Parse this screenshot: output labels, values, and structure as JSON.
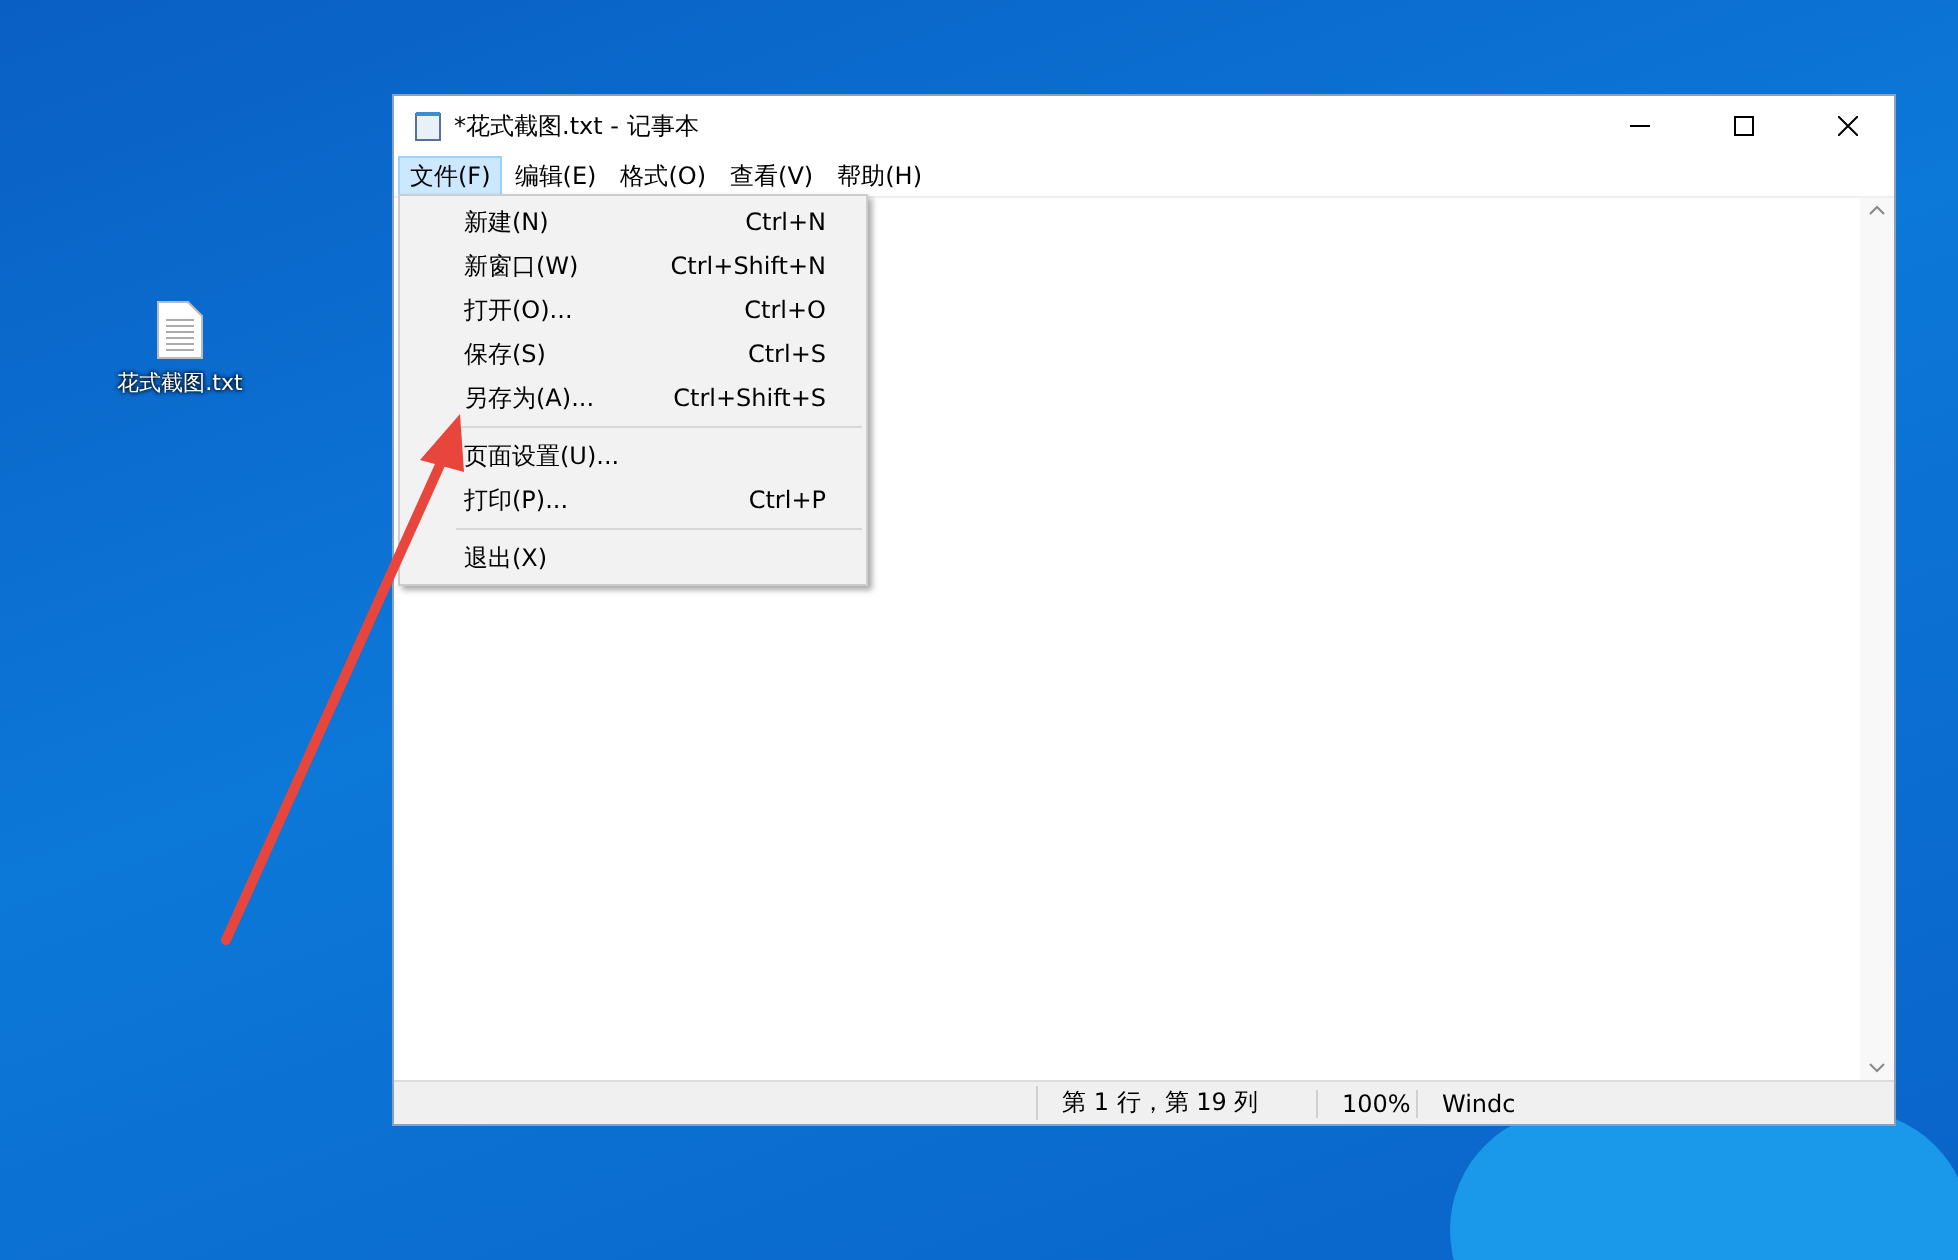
{
  "desktop_icon": {
    "label": "花式截图.txt"
  },
  "window": {
    "title": "*花式截图.txt - 记事本"
  },
  "menu_bar": [
    {
      "label": "文件(F)",
      "selected": true
    },
    {
      "label": "编辑(E)",
      "selected": false
    },
    {
      "label": "格式(O)",
      "selected": false
    },
    {
      "label": "查看(V)",
      "selected": false
    },
    {
      "label": "帮助(H)",
      "selected": false
    }
  ],
  "file_menu": [
    {
      "kind": "item",
      "label": "新建(N)",
      "shortcut": "Ctrl+N"
    },
    {
      "kind": "item",
      "label": "新窗口(W)",
      "shortcut": "Ctrl+Shift+N"
    },
    {
      "kind": "item",
      "label": "打开(O)...",
      "shortcut": "Ctrl+O"
    },
    {
      "kind": "item",
      "label": "保存(S)",
      "shortcut": "Ctrl+S"
    },
    {
      "kind": "item",
      "label": "另存为(A)...",
      "shortcut": "Ctrl+Shift+S"
    },
    {
      "kind": "separator"
    },
    {
      "kind": "item",
      "label": "页面设置(U)..."
    },
    {
      "kind": "item",
      "label": "打印(P)...",
      "shortcut": "Ctrl+P"
    },
    {
      "kind": "separator"
    },
    {
      "kind": "item",
      "label": "退出(X)"
    }
  ],
  "status_bar": {
    "position": "第 1 行，第 19 列",
    "zoom": "100%",
    "encoding": "Windc"
  }
}
